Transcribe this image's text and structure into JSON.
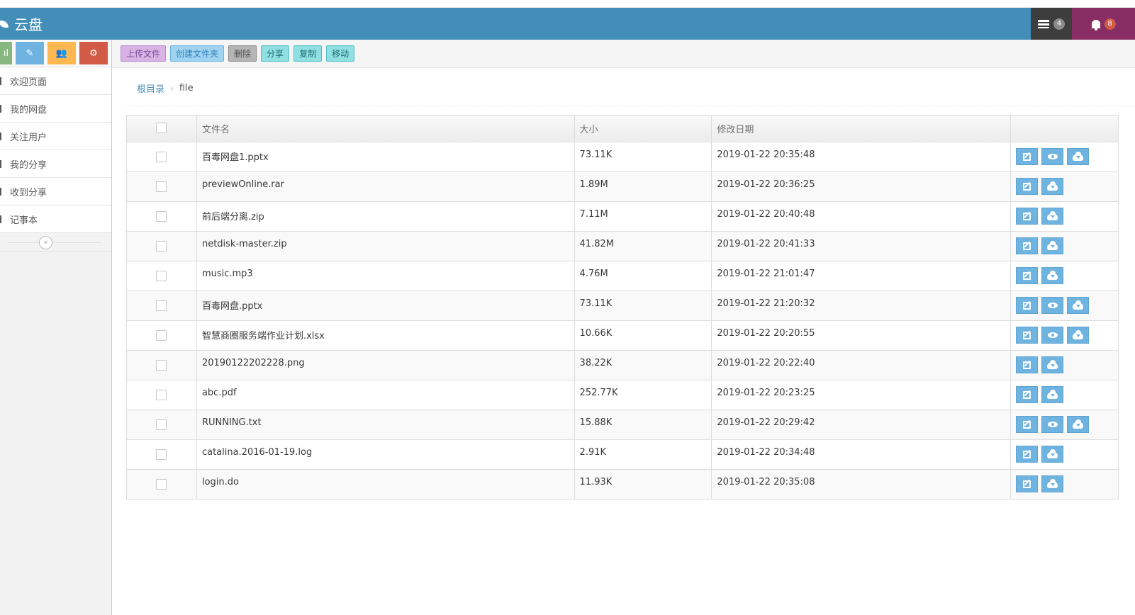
{
  "navbar": {
    "brand": "云盘",
    "tasks_count": "4",
    "notifications_count": "8"
  },
  "shortcuts": [
    {
      "icon": "stats-icon",
      "color": "#87b87f",
      "label": "ıl"
    },
    {
      "icon": "pencil-icon",
      "color": "#6fb3e0",
      "label": "✎"
    },
    {
      "icon": "group-icon",
      "color": "#ffb752",
      "label": "👥"
    },
    {
      "icon": "cogs-icon",
      "color": "#d15b47",
      "label": "⚙"
    }
  ],
  "sidebar": {
    "items": [
      {
        "label": "欢迎页面"
      },
      {
        "label": "我的网盘"
      },
      {
        "label": "关注用户"
      },
      {
        "label": "我的分享"
      },
      {
        "label": "收到分享"
      },
      {
        "label": "记事本"
      }
    ],
    "collapse_glyph": "«"
  },
  "toolbar": {
    "upload": "上传文件",
    "mkdir": "创建文件夹",
    "delete": "删除",
    "share": "分享",
    "copy": "复制",
    "move": "移动"
  },
  "breadcrumb": {
    "root": "根目录",
    "separator": "›",
    "current": "file"
  },
  "table": {
    "headers": {
      "name": "文件名",
      "size": "大小",
      "date": "修改日期"
    },
    "rows": [
      {
        "name": "百毒网盘1.pptx",
        "size": "73.11K",
        "date": "2019-01-22 20:35:48",
        "preview": true
      },
      {
        "name": "previewOnline.rar",
        "size": "1.89M",
        "date": "2019-01-22 20:36:25",
        "preview": false
      },
      {
        "name": "前后端分离.zip",
        "size": "7.11M",
        "date": "2019-01-22 20:40:48",
        "preview": false
      },
      {
        "name": "netdisk-master.zip",
        "size": "41.82M",
        "date": "2019-01-22 20:41:33",
        "preview": false
      },
      {
        "name": "music.mp3",
        "size": "4.76M",
        "date": "2019-01-22 21:01:47",
        "preview": false
      },
      {
        "name": "百毒网盘.pptx",
        "size": "73.11K",
        "date": "2019-01-22 21:20:32",
        "preview": true
      },
      {
        "name": "智慧商圈服务端作业计划.xlsx",
        "size": "10.66K",
        "date": "2019-01-22 20:20:55",
        "preview": true
      },
      {
        "name": "20190122202228.png",
        "size": "38.22K",
        "date": "2019-01-22 20:22:40",
        "preview": false
      },
      {
        "name": "abc.pdf",
        "size": "252.77K",
        "date": "2019-01-22 20:23:25",
        "preview": false
      },
      {
        "name": "RUNNING.txt",
        "size": "15.88K",
        "date": "2019-01-22 20:29:42",
        "preview": true
      },
      {
        "name": "catalina.2016-01-19.log",
        "size": "2.91K",
        "date": "2019-01-22 20:34:48",
        "preview": false
      },
      {
        "name": "login.do",
        "size": "11.93K",
        "date": "2019-01-22 20:35:08",
        "preview": false
      }
    ]
  }
}
